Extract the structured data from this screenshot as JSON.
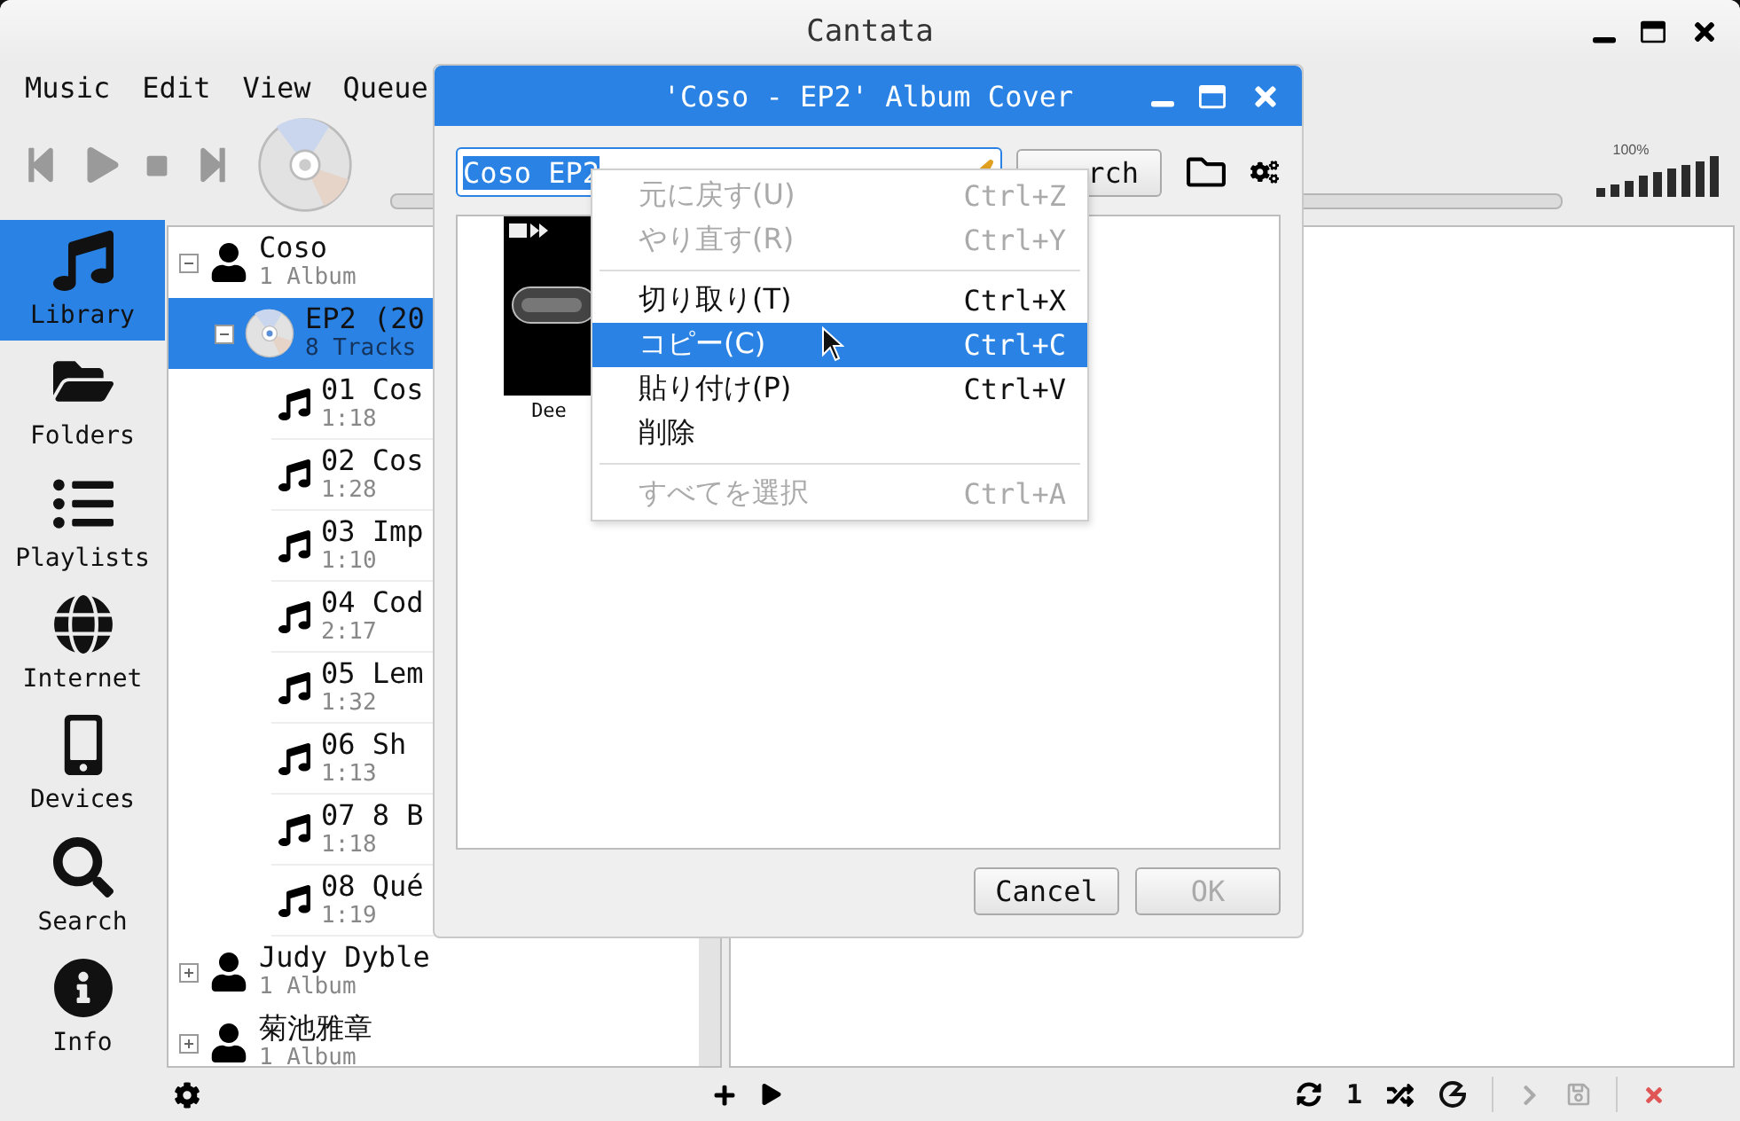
{
  "window": {
    "title": "Cantata"
  },
  "menu": [
    "Music",
    "Edit",
    "View",
    "Queue"
  ],
  "volume": {
    "reading": "100%"
  },
  "sidebar": [
    {
      "label": "Library",
      "selected": true
    },
    {
      "label": "Folders",
      "selected": false
    },
    {
      "label": "Playlists",
      "selected": false
    },
    {
      "label": "Internet",
      "selected": false
    },
    {
      "label": "Devices",
      "selected": false
    },
    {
      "label": "Search",
      "selected": false
    },
    {
      "label": "Info",
      "selected": false
    }
  ],
  "tree": [
    {
      "name": "Coso",
      "info": "1 Album",
      "expanded": true,
      "children": [
        {
          "name": "EP2 (20",
          "info": "8 Tracks",
          "expanded": true,
          "selected": true,
          "children": [
            {
              "title": "01 Cos",
              "duration": "1:18"
            },
            {
              "title": "02 Cos",
              "duration": "1:28"
            },
            {
              "title": "03 Imp",
              "duration": "1:10"
            },
            {
              "title": "04 Cod",
              "duration": "2:17"
            },
            {
              "title": "05 Lem",
              "duration": "1:32"
            },
            {
              "title": "06 Sh",
              "duration": "1:13"
            },
            {
              "title": "07 8 B",
              "duration": "1:18"
            },
            {
              "title": "08 Qué",
              "duration": "1:19"
            }
          ]
        }
      ]
    },
    {
      "name": "Judy Dyble",
      "info": "1 Album",
      "expanded": false
    },
    {
      "name": "菊池雅章",
      "info": "1 Album",
      "expanded": false
    }
  ],
  "status_bar": {
    "single": "1"
  },
  "dialog": {
    "title": "'Coso - EP2' Album Cover",
    "search": {
      "value": "Coso EP2",
      "text_selected": true
    },
    "search_button": "rch",
    "covers": [
      {
        "label": "Dee"
      }
    ],
    "buttons": [
      {
        "label": "Cancel",
        "disabled": false
      },
      {
        "label": "OK",
        "disabled": true
      }
    ]
  },
  "context_menu": [
    {
      "kind": "item",
      "label": "元に戻す(U)",
      "shortcut": "Ctrl+Z",
      "disabled": true,
      "selected": false
    },
    {
      "kind": "item",
      "label": "やり直す(R)",
      "shortcut": "Ctrl+Y",
      "disabled": true,
      "selected": false
    },
    {
      "kind": "separator"
    },
    {
      "kind": "item",
      "label": "切り取り(T)",
      "shortcut": "Ctrl+X",
      "disabled": false,
      "selected": false
    },
    {
      "kind": "item",
      "label": "コピー(C)",
      "shortcut": "Ctrl+C",
      "disabled": false,
      "selected": true
    },
    {
      "kind": "item",
      "label": "貼り付け(P)",
      "shortcut": "Ctrl+V",
      "disabled": false,
      "selected": false
    },
    {
      "kind": "item",
      "label": "削除",
      "disabled": false,
      "selected": false
    },
    {
      "kind": "separator"
    },
    {
      "kind": "item",
      "label": "すべてを選択",
      "shortcut": "Ctrl+A",
      "disabled": true,
      "selected": false
    }
  ]
}
